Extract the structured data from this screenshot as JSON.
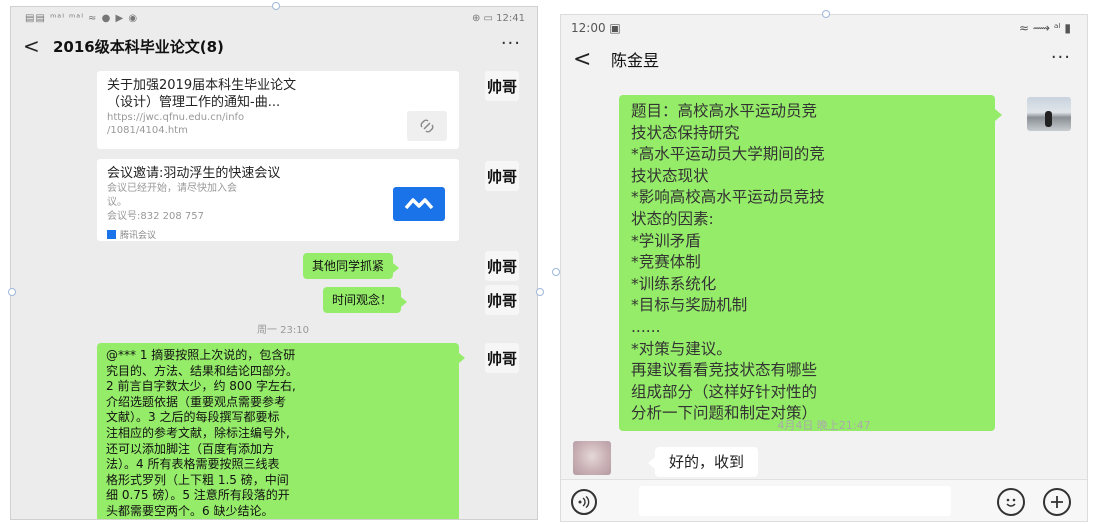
{
  "left": {
    "status": {
      "left": "▤▤ ᵐᵃˡ ᵐᵃˡ ≈ ● ▶ ◉",
      "right": "⊕ ▭ 12:41"
    },
    "header": {
      "back": "<",
      "title": "2016级本科毕业论文(8)",
      "more": "···"
    },
    "sender_avatar_text": "帅哥",
    "card_notice": {
      "title_1": "关于加强2019届本科生毕业论文",
      "title_2": "（设计）管理工作的通知-曲...",
      "url_1": "https://jwc.qfnu.edu.cn/info",
      "url_2": "/1081/4104.htm"
    },
    "card_meeting": {
      "title": "会议邀请:羽动浮生的快速会议",
      "desc_1": "会议已经开始，请尽快加入会",
      "desc_2": "议。",
      "id": "会议号:832 208 757",
      "source": "腾讯会议"
    },
    "msg1": "其他同学抓紧",
    "msg2": "时间观念！",
    "timestamp": "周一 23:10",
    "long_msg": [
      "@*** 1 摘要按照上次说的，包含研",
      "究目的、方法、结果和结论四部分。",
      "2 前言自字数太少，约 800 字左右,",
      "介绍选题依据（重要观点需要参考",
      "文献）。3 之后的每段撰写都要标",
      "注相应的参考文献，除标注编号外,",
      "还可以添加脚注（百度有添加方",
      "法）。4 所有表格需要按照三线表",
      "格形式罗列（上下粗 1.5 磅，中间",
      "细 0.75 磅）。5 注意所有段落的开",
      "头都需要空两个。6 缺少结论。"
    ]
  },
  "right": {
    "status": {
      "time": "12:00 ▣",
      "icons": "≈ ⟿ ᵃˡ ▮"
    },
    "header": {
      "back": "<",
      "title": "陈金昱",
      "more": "···"
    },
    "bubble_lines": [
      "题目：高校高水平运动员竞",
      "技状态保持研究",
      "*高水平运动员大学期间的竞",
      "技状态现状",
      "*影响高校高水平运动员竞技",
      "状态的因素:",
      "*学训矛盾",
      "*竞赛体制",
      "*训练系统化",
      "*目标与奖励机制",
      "......",
      "*对策与建议。",
      "再建议看看竞技状态有哪些",
      "组成部分（这样好针对性的",
      "分析一下问题和制定对策）"
    ],
    "timestamp": "4月4日 晚上21:47",
    "reply": "好的，收到",
    "icons": {
      "voice": "voice-icon",
      "emoji": "emoji-icon",
      "plus": "plus-icon"
    }
  },
  "colors": {
    "bubble_green": "#95ec69",
    "chat_bg_left": "#ececec",
    "chat_bg_right": "#f2f2f2",
    "meeting_blue": "#1a73e8"
  }
}
